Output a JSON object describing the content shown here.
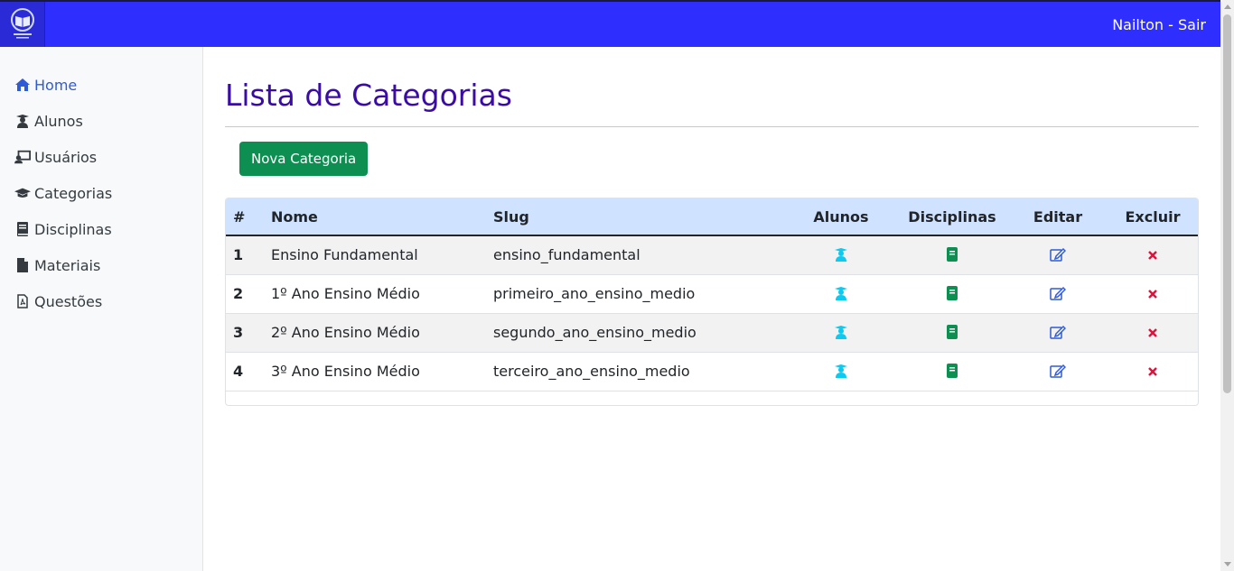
{
  "header": {
    "user_link": "Nailton - Sair",
    "logo_icon": "school-shield-logo"
  },
  "sidebar": {
    "items": [
      {
        "label": "Home",
        "icon": "home-icon",
        "active": true
      },
      {
        "label": "Alunos",
        "icon": "student-icon",
        "active": false
      },
      {
        "label": "Usuários",
        "icon": "chalkboard-user-icon",
        "active": false
      },
      {
        "label": "Categorias",
        "icon": "graduation-cap-icon",
        "active": false
      },
      {
        "label": "Disciplinas",
        "icon": "book-icon",
        "active": false
      },
      {
        "label": "Materiais",
        "icon": "file-icon",
        "active": false
      },
      {
        "label": "Questões",
        "icon": "file-pdf-icon",
        "active": false
      }
    ]
  },
  "main": {
    "title": "Lista de Categorias",
    "new_button": "Nova Categoria",
    "table": {
      "headers": [
        "#",
        "Nome",
        "Slug",
        "Alunos",
        "Disciplinas",
        "Editar",
        "Excluir"
      ],
      "rows": [
        {
          "id": "1",
          "nome": "Ensino Fundamental",
          "slug": "ensino_fundamental"
        },
        {
          "id": "2",
          "nome": "1º Ano Ensino Médio",
          "slug": "primeiro_ano_ensino_medio"
        },
        {
          "id": "3",
          "nome": "2º Ano Ensino Médio",
          "slug": "segundo_ano_ensino_medio"
        },
        {
          "id": "4",
          "nome": "3º Ano Ensino Médio",
          "slug": "terceiro_ano_ensino_medio"
        }
      ]
    }
  },
  "colors": {
    "topbar": "#2e2eff",
    "title": "#3a0ca3",
    "button": "#0d8f52",
    "alunos_icon": "#0dcaf0",
    "disciplinas_icon": "#0d8f52",
    "edit_icon": "#2e5bd6",
    "delete_icon": "#dc143c",
    "table_header": "#cfe2ff"
  }
}
